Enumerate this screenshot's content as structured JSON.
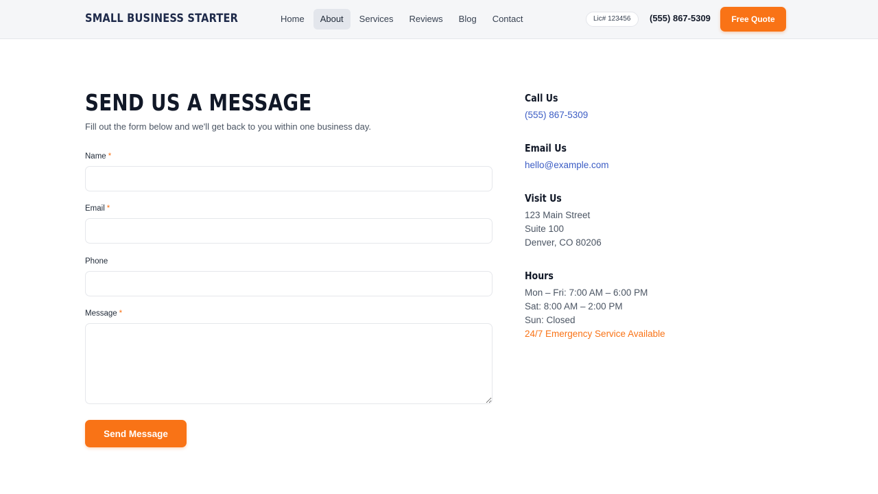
{
  "header": {
    "brand": "SMALL BUSINESS STARTER",
    "nav": [
      "Home",
      "About",
      "Services",
      "Reviews",
      "Blog",
      "Contact"
    ],
    "active_nav": "About",
    "license": "Lic# 123456",
    "phone": "(555) 867-5309",
    "cta_label": "Free Quote"
  },
  "form": {
    "title": "SEND US A MESSAGE",
    "subtitle": "Fill out the form below and we'll get back to you within one business day.",
    "required_marker": "*",
    "fields": {
      "name": {
        "label": "Name",
        "value": "",
        "placeholder": ""
      },
      "email": {
        "label": "Email",
        "value": "",
        "placeholder": ""
      },
      "phone": {
        "label": "Phone",
        "value": "",
        "placeholder": ""
      },
      "message": {
        "label": "Message",
        "value": "",
        "placeholder": ""
      }
    },
    "submit_label": "Send Message"
  },
  "contact": {
    "call": {
      "heading": "Call Us",
      "value": "(555) 867-5309"
    },
    "email": {
      "heading": "Email Us",
      "value": "hello@example.com"
    },
    "visit": {
      "heading": "Visit Us",
      "lines": [
        "123 Main Street",
        "Suite 100",
        "Denver, CO 80206"
      ]
    },
    "hours": {
      "heading": "Hours",
      "lines": [
        "Mon – Fri: 7:00 AM – 6:00 PM",
        "Sat: 8:00 AM – 2:00 PM",
        "Sun: Closed"
      ],
      "emergency": "24/7 Emergency Service Available"
    }
  },
  "colors": {
    "accent": "#f97316",
    "link": "#3b5cc4",
    "brand": "#1e2a4a",
    "header_bg": "#f5f6f8"
  }
}
